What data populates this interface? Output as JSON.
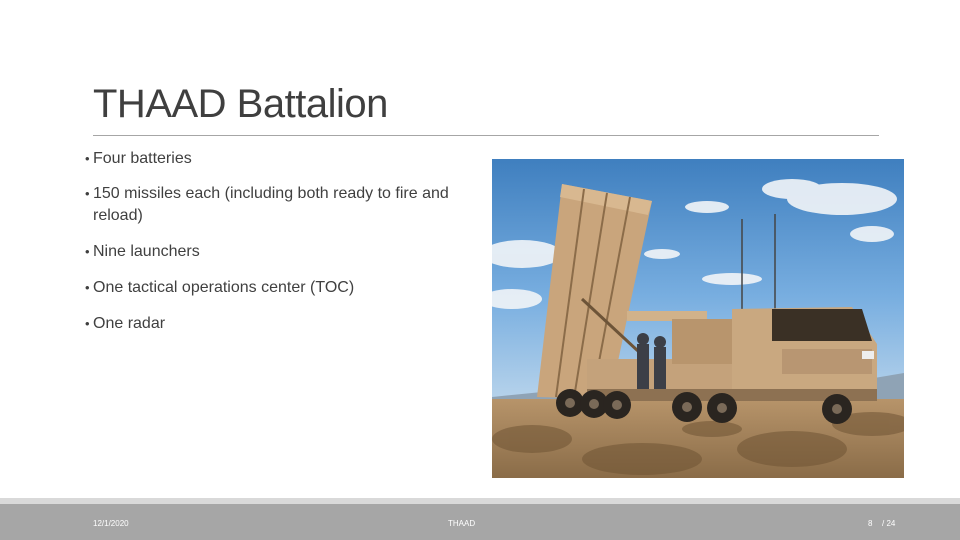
{
  "slide": {
    "title": "THAAD Battalion",
    "bullets": [
      {
        "marker": "•",
        "text": "Four batteries"
      },
      {
        "marker": "•",
        "text": "150 missiles each (including both ready to fire and reload)"
      },
      {
        "marker": "•",
        "text": "Nine launchers"
      },
      {
        "marker": "•",
        "text": "One tactical operations center (TOC)"
      },
      {
        "marker": "•",
        "text": "One radar"
      }
    ]
  },
  "footer": {
    "date": "12/1/2020",
    "center_label": "THAAD",
    "page_number": "8",
    "page_total": "/ 24"
  },
  "colors": {
    "title": "#3f3f3f",
    "rule": "#a6a6a6",
    "footer_band": "#a6a6a6",
    "footer_band_light": "#d9d9d9"
  }
}
